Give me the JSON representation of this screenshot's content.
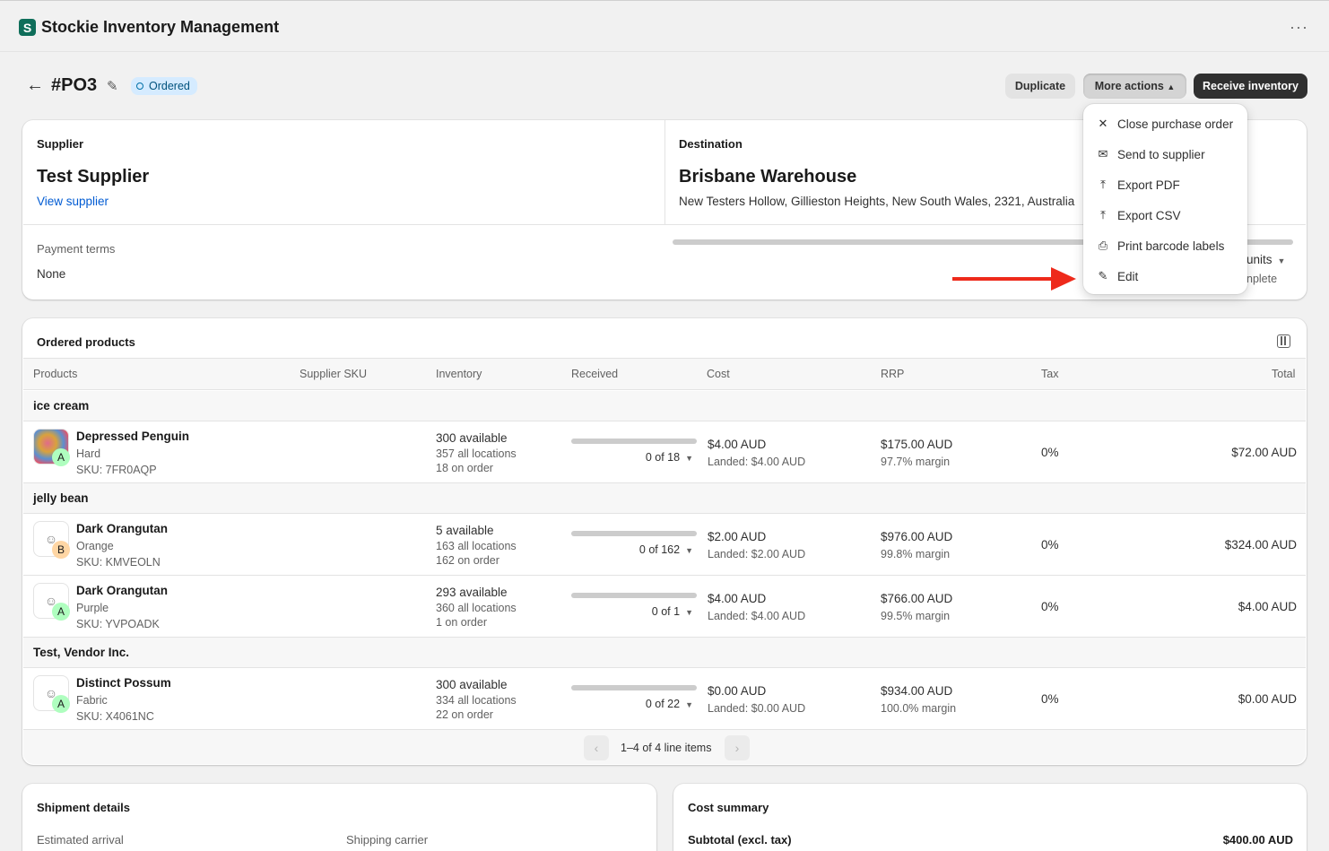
{
  "app": {
    "title": "Stockie Inventory Management",
    "logo_letter": "S",
    "more": "···"
  },
  "header": {
    "back": "←",
    "po_number": "#PO3",
    "status": "Ordered",
    "buttons": {
      "duplicate": "Duplicate",
      "more_actions": "More actions",
      "receive": "Receive inventory"
    }
  },
  "supplier": {
    "label": "Supplier",
    "name": "Test Supplier",
    "link": "View supplier"
  },
  "destination": {
    "label": "Destination",
    "name": "Brisbane Warehouse",
    "address": "New Testers Hollow, Gillieston Heights, New South Wales, 2321, Australia"
  },
  "payment": {
    "label": "Payment terms",
    "value": "None"
  },
  "progress_partial": {
    "units": "units",
    "complete": "nplete",
    "received_fraction": 0
  },
  "menu": {
    "items": [
      {
        "icon": "close-icon",
        "glyph": "✕",
        "label": "Close purchase order"
      },
      {
        "icon": "mail-icon",
        "glyph": "✉",
        "label": "Send to supplier"
      },
      {
        "icon": "export-icon",
        "glyph": "⤒",
        "label": "Export PDF"
      },
      {
        "icon": "export-icon",
        "glyph": "⤒",
        "label": "Export CSV"
      },
      {
        "icon": "printer-icon",
        "glyph": "⎙",
        "label": "Print barcode labels"
      },
      {
        "icon": "pencil-icon",
        "glyph": "✎",
        "label": "Edit"
      }
    ]
  },
  "products": {
    "title": "Ordered products",
    "columns": [
      "Products",
      "Supplier SKU",
      "Inventory",
      "Received",
      "Cost",
      "RRP",
      "Tax",
      "Total"
    ],
    "groups": [
      {
        "name": "ice cream",
        "rows": [
          {
            "name": "Depressed Penguin",
            "variant": "Hard",
            "sku": "SKU: 7FR0AQP",
            "badge": "A",
            "available": "300 available",
            "locations": "357 all locations",
            "on_order": "18 on order",
            "received": "0 of 18",
            "cost": "$4.00 AUD",
            "landed": "Landed: $4.00 AUD",
            "rrp": "$175.00 AUD",
            "margin": "97.7% margin",
            "tax": "0%",
            "total": "$72.00 AUD"
          }
        ]
      },
      {
        "name": "jelly bean",
        "rows": [
          {
            "name": "Dark Orangutan",
            "variant": "Orange",
            "sku": "SKU: KMVEOLN",
            "badge": "B",
            "available": "5 available",
            "locations": "163 all locations",
            "on_order": "162 on order",
            "received": "0 of 162",
            "cost": "$2.00 AUD",
            "landed": "Landed: $2.00 AUD",
            "rrp": "$976.00 AUD",
            "margin": "99.8% margin",
            "tax": "0%",
            "total": "$324.00 AUD"
          },
          {
            "name": "Dark Orangutan",
            "variant": "Purple",
            "sku": "SKU: YVPOADK",
            "badge": "A",
            "available": "293 available",
            "locations": "360 all locations",
            "on_order": "1 on order",
            "received": "0 of 1",
            "cost": "$4.00 AUD",
            "landed": "Landed: $4.00 AUD",
            "rrp": "$766.00 AUD",
            "margin": "99.5% margin",
            "tax": "0%",
            "total": "$4.00 AUD"
          }
        ]
      },
      {
        "name": "Test, Vendor Inc.",
        "rows": [
          {
            "name": "Distinct Possum",
            "variant": "Fabric",
            "sku": "SKU: X4061NC",
            "badge": "A",
            "available": "300 available",
            "locations": "334 all locations",
            "on_order": "22 on order",
            "received": "0 of 22",
            "cost": "$0.00 AUD",
            "landed": "Landed: $0.00 AUD",
            "rrp": "$934.00 AUD",
            "margin": "100.0% margin",
            "tax": "0%",
            "total": "$0.00 AUD"
          }
        ]
      }
    ],
    "pagination": "1–4 of 4 line items"
  },
  "shipment": {
    "title": "Shipment details",
    "estimated_arrival": "Estimated arrival",
    "carrier": "Shipping carrier"
  },
  "cost_summary": {
    "title": "Cost summary",
    "subtotal_label": "Subtotal (excl. tax)",
    "subtotal": "$400.00 AUD"
  }
}
